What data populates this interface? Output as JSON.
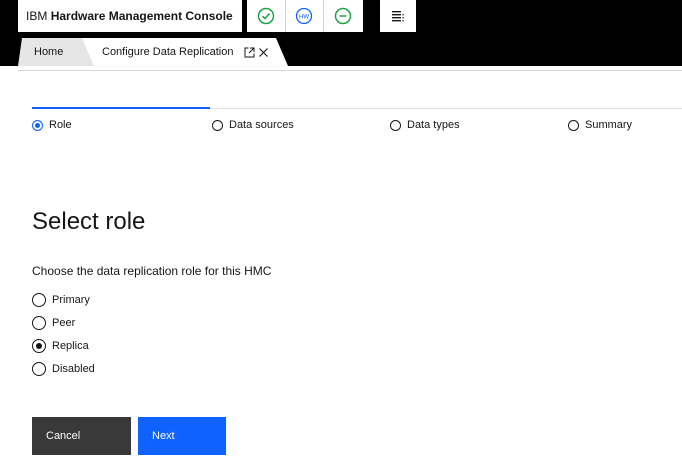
{
  "app": {
    "brand_prefix": "IBM",
    "brand_name": "Hardware Management Console"
  },
  "header": {
    "status_icons": [
      "check-circle-icon",
      "hw-icon",
      "minus-circle-icon"
    ],
    "hw_icon_text": "HW",
    "menu_icon": "menu-icon"
  },
  "tabs": [
    {
      "label": "Home"
    },
    {
      "label": "Configure Data Replication"
    }
  ],
  "stepper": {
    "steps": [
      {
        "label": "Role",
        "state": "current"
      },
      {
        "label": "Data sources",
        "state": "incomplete"
      },
      {
        "label": "Data types",
        "state": "incomplete"
      },
      {
        "label": "Summary",
        "state": "incomplete"
      }
    ]
  },
  "content": {
    "title": "Select role",
    "subtitle": "Choose the data replication role for this HMC",
    "options": [
      {
        "label": "Primary",
        "checked": false
      },
      {
        "label": "Peer",
        "checked": false
      },
      {
        "label": "Replica",
        "checked": true
      },
      {
        "label": "Disabled",
        "checked": false
      }
    ]
  },
  "actions": {
    "cancel_label": "Cancel",
    "next_label": "Next"
  },
  "colors": {
    "accent": "#0f62fe",
    "secondary_button": "#393939",
    "header_bg": "#000000",
    "status_green": "#24a148",
    "status_blue": "#0f62fe"
  }
}
